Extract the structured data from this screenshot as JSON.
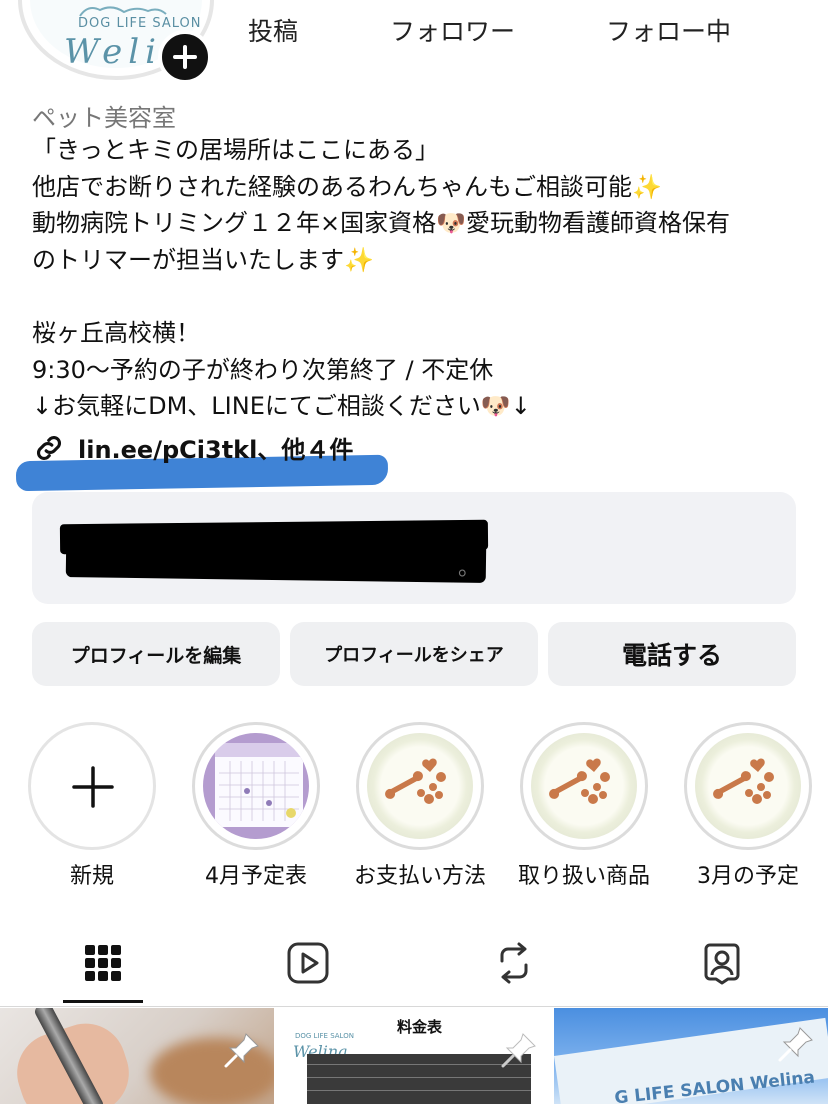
{
  "profile": {
    "logo": {
      "sub": "DOG LIFE SALON",
      "main": "Welin"
    },
    "stats": [
      {
        "label": "投稿"
      },
      {
        "label": "フォロワー"
      },
      {
        "label": "フォロー中"
      }
    ],
    "category": "ペット美容室",
    "bio_lines": [
      "「きっとキミの居場所はここにある」",
      "他店でお断りされた経験のあるわんちゃんもご相談可能✨",
      "動物病院トリミング１２年×国家資格🐶愛玩動物看護師資格保有",
      "のトリマーが担当いたします✨",
      "",
      "桜ヶ丘高校横！",
      "9:30〜予約の子が終わり次第終了 / 不定休",
      "↓お気軽にDM、LINEにてご相談ください🐶↓"
    ],
    "link_text": "lin.ee/pCi3tkl、他４件",
    "card_tail_text": "。"
  },
  "buttons": {
    "edit": "プロフィールを編集",
    "share": "プロフィールをシェア",
    "call": "電話する"
  },
  "highlights": [
    {
      "label": "新規",
      "type": "new"
    },
    {
      "label": "4月予定表",
      "type": "calendar"
    },
    {
      "label": "お支払い方法",
      "type": "cookies"
    },
    {
      "label": "取り扱い商品",
      "type": "cookies"
    },
    {
      "label": "3月の予定",
      "type": "cookies"
    }
  ],
  "tabs": [
    {
      "icon": "grid-icon",
      "active": true
    },
    {
      "icon": "reels-icon",
      "active": false
    },
    {
      "icon": "reposts-icon",
      "active": false
    },
    {
      "icon": "tagged-icon",
      "active": false
    }
  ],
  "posts": [
    {
      "kind": "photo-clippers"
    },
    {
      "kind": "price-list",
      "title": "料金表",
      "logo": "Welina",
      "logo_sub": "DOG LIFE SALON"
    },
    {
      "kind": "photo-sign",
      "sign_text": "G LIFE SALON Welina"
    }
  ],
  "colors": {
    "link_scribble": "#3f83d6",
    "button_bg": "#eff0f2",
    "accent": "#5b93a8"
  }
}
